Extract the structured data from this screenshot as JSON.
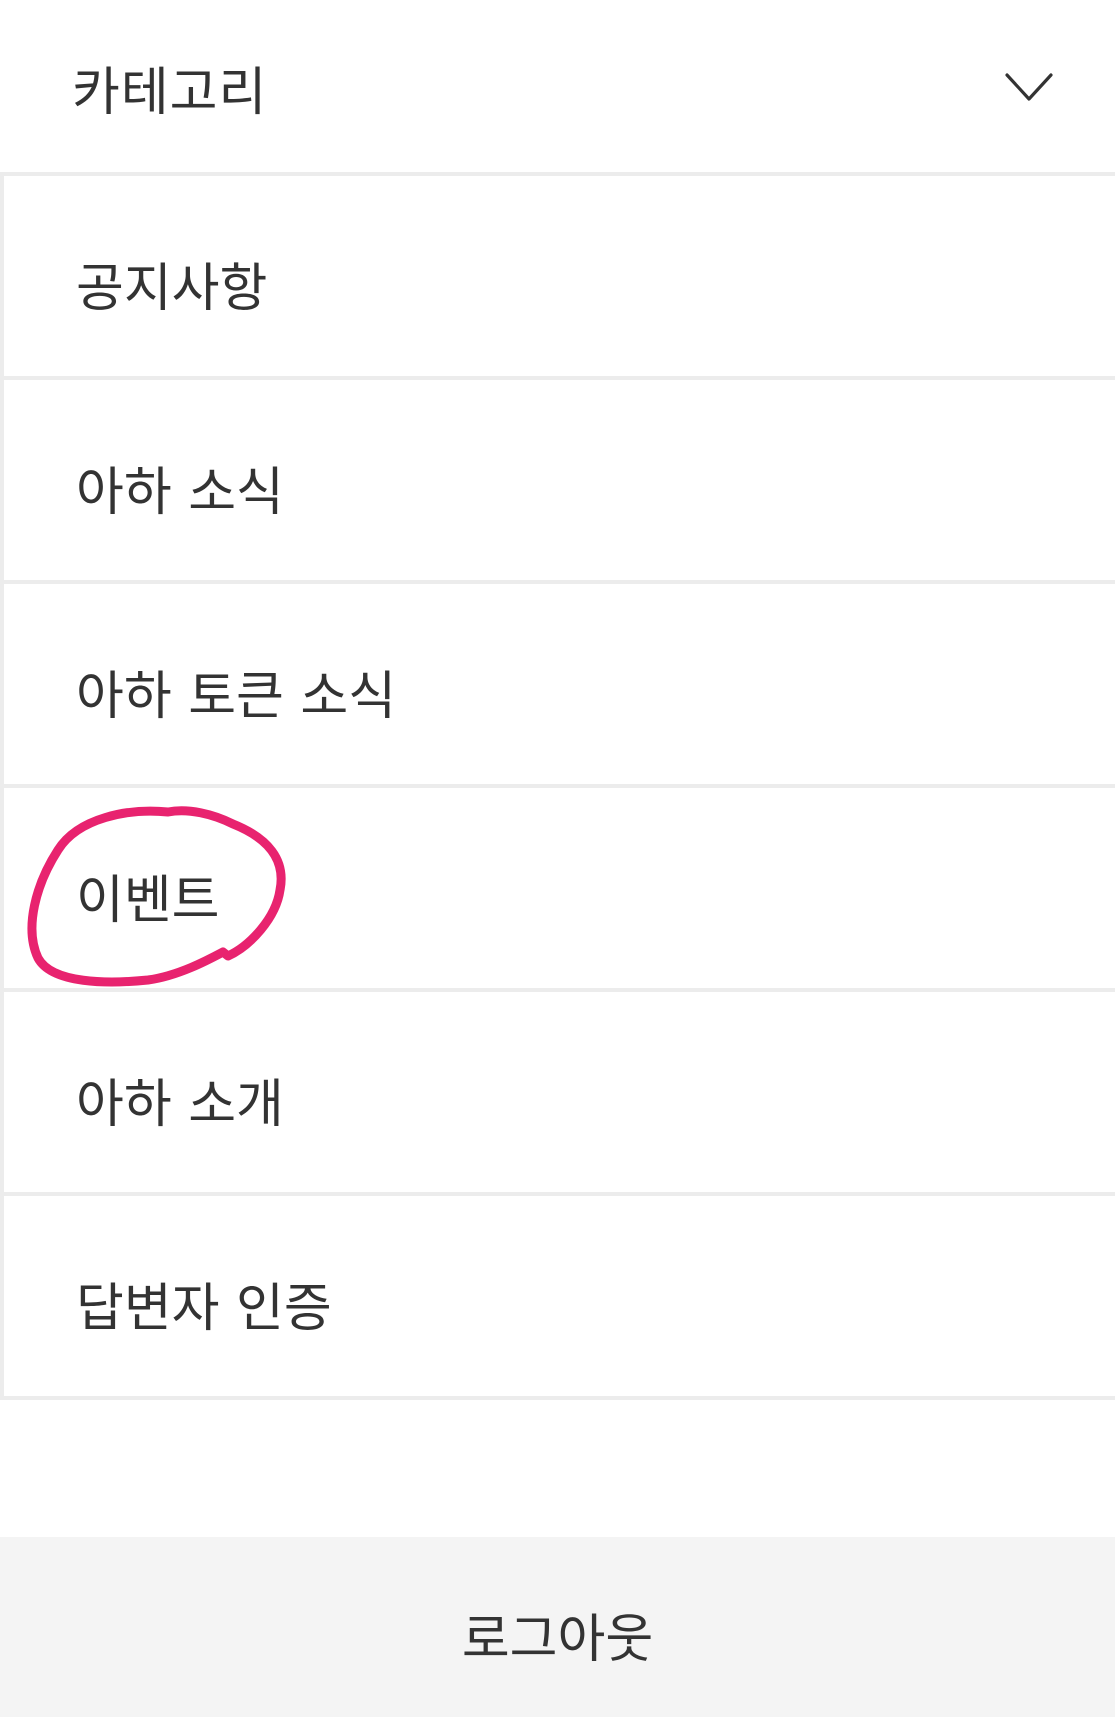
{
  "header": {
    "title": "카테고리",
    "toggle_icon": "chevron-down-icon"
  },
  "menu": {
    "items": [
      {
        "label": "공지사항"
      },
      {
        "label": "아하 소식"
      },
      {
        "label": "아하 토큰 소식"
      },
      {
        "label": "이벤트",
        "annotated": true
      },
      {
        "label": "아하 소개"
      },
      {
        "label": "답변자 인증"
      }
    ]
  },
  "annotation": {
    "color": "#e8236f",
    "target": "이벤트"
  },
  "footer": {
    "logout_label": "로그아웃"
  },
  "colors": {
    "text": "#333333",
    "divider": "#ececec",
    "footer_bg": "#f4f4f4"
  }
}
